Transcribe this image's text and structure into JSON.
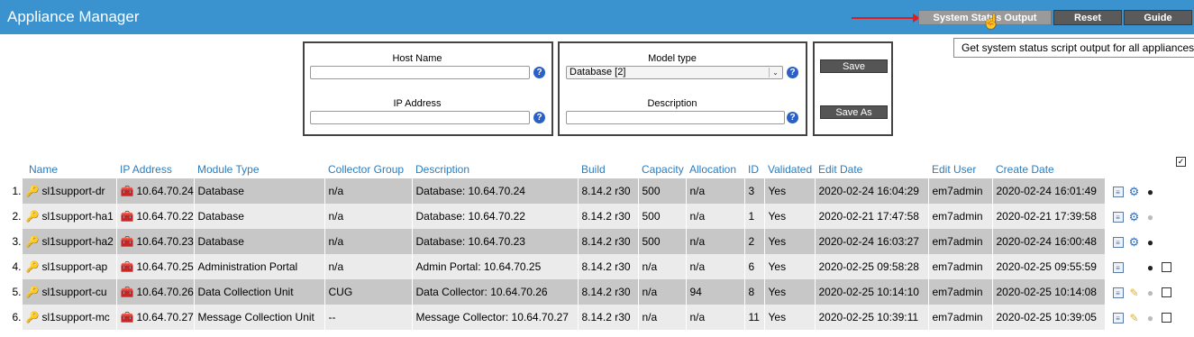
{
  "header": {
    "title": "Appliance Manager",
    "buttons": [
      "System Status Output",
      "Reset",
      "Guide"
    ],
    "tooltip": "Get system status script output for all appliances."
  },
  "filters": {
    "host_name_label": "Host Name",
    "host_name_value": "",
    "ip_label": "IP Address",
    "ip_value": "",
    "model_label": "Model type",
    "model_value": "Database [2]",
    "description_label": "Description",
    "description_value": "",
    "save_label": "Save",
    "save_as_label": "Save As"
  },
  "table": {
    "columns": [
      "Name",
      "IP Address",
      "Module Type",
      "Collector Group",
      "Description",
      "Build",
      "Capacity",
      "Allocation",
      "ID",
      "Validated",
      "Edit Date",
      "Edit User",
      "Create Date"
    ],
    "rows": [
      {
        "n": "1.",
        "name": "sl1support-dr",
        "ip": "10.64.70.24",
        "module": "Database",
        "collector": "n/a",
        "description": "Database: 10.64.70.24",
        "build": "8.14.2 r30",
        "capacity": "500",
        "allocation": "n/a",
        "id": "3",
        "validated": "Yes",
        "edit_date": "2020-02-24 16:04:29",
        "edit_user": "em7admin",
        "create_date": "2020-02-24 16:01:49",
        "actions": [
          "doc",
          "gear",
          "bomb"
        ],
        "checkbox": false
      },
      {
        "n": "2.",
        "name": "sl1support-ha1",
        "ip": "10.64.70.22",
        "module": "Database",
        "collector": "n/a",
        "description": "Database: 10.64.70.22",
        "build": "8.14.2 r30",
        "capacity": "500",
        "allocation": "n/a",
        "id": "1",
        "validated": "Yes",
        "edit_date": "2020-02-21 17:47:58",
        "edit_user": "em7admin",
        "create_date": "2020-02-21 17:39:58",
        "actions": [
          "doc",
          "gear",
          "bomb-gray"
        ],
        "checkbox": false
      },
      {
        "n": "3.",
        "name": "sl1support-ha2",
        "ip": "10.64.70.23",
        "module": "Database",
        "collector": "n/a",
        "description": "Database: 10.64.70.23",
        "build": "8.14.2 r30",
        "capacity": "500",
        "allocation": "n/a",
        "id": "2",
        "validated": "Yes",
        "edit_date": "2020-02-24 16:03:27",
        "edit_user": "em7admin",
        "create_date": "2020-02-24 16:00:48",
        "actions": [
          "doc",
          "gear",
          "bomb"
        ],
        "checkbox": false
      },
      {
        "n": "4.",
        "name": "sl1support-ap",
        "ip": "10.64.70.25",
        "module": "Administration Portal",
        "collector": "n/a",
        "description": "Admin Portal: 10.64.70.25",
        "build": "8.14.2 r30",
        "capacity": "n/a",
        "allocation": "n/a",
        "id": "6",
        "validated": "Yes",
        "edit_date": "2020-02-25 09:58:28",
        "edit_user": "em7admin",
        "create_date": "2020-02-25 09:55:59",
        "actions": [
          "doc",
          "none",
          "bomb"
        ],
        "checkbox": true
      },
      {
        "n": "5.",
        "name": "sl1support-cu",
        "ip": "10.64.70.26",
        "module": "Data Collection Unit",
        "collector": "CUG",
        "description": "Data Collector: 10.64.70.26",
        "build": "8.14.2 r30",
        "capacity": "n/a",
        "allocation": "94",
        "id": "8",
        "validated": "Yes",
        "edit_date": "2020-02-25 10:14:10",
        "edit_user": "em7admin",
        "create_date": "2020-02-25 10:14:08",
        "actions": [
          "doc",
          "pencil",
          "bomb-gray"
        ],
        "checkbox": true
      },
      {
        "n": "6.",
        "name": "sl1support-mc",
        "ip": "10.64.70.27",
        "module": "Message Collection Unit",
        "collector": "--",
        "description": "Message Collector: 10.64.70.27",
        "build": "8.14.2 r30",
        "capacity": "n/a",
        "allocation": "n/a",
        "id": "11",
        "validated": "Yes",
        "edit_date": "2020-02-25 10:39:11",
        "edit_user": "em7admin",
        "create_date": "2020-02-25 10:39:05",
        "actions": [
          "doc",
          "pencil",
          "bomb-gray"
        ],
        "checkbox": true
      }
    ]
  }
}
